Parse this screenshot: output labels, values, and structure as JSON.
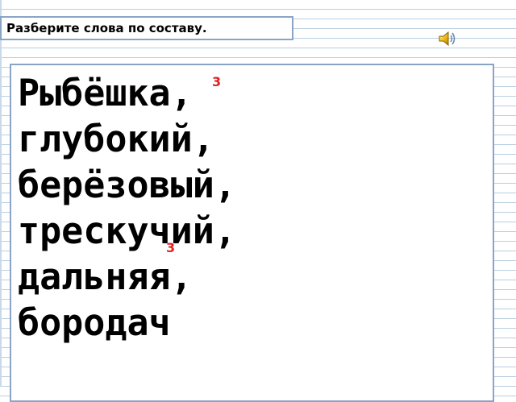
{
  "task": {
    "instruction": "Разберите слова по составу."
  },
  "words": [
    "Рыбёшка,",
    "глубокий,",
    "берёзовый,",
    "трескучий,",
    "дальняя,",
    "бородач"
  ],
  "marks": {
    "first": "3",
    "second": "3"
  },
  "icons": {
    "audio": "speaker-icon"
  },
  "colors": {
    "frame_border": "#8aa4c6",
    "ruled_line": "#b9cfe0",
    "mark_red": "#e02020"
  }
}
